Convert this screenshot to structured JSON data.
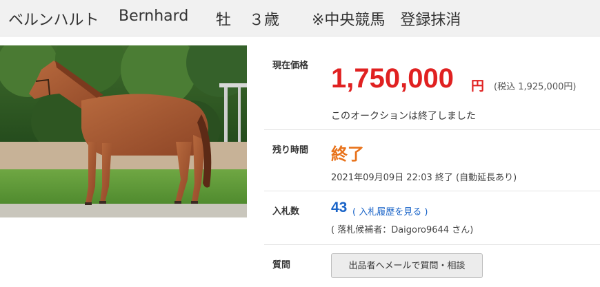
{
  "header": {
    "name_kana": "ベルンハルト",
    "name_en": "Bernhard",
    "sex": "牡",
    "age": "３歳",
    "status": "※中央競馬　登録抹消"
  },
  "photo": {
    "alt": "horse-photo",
    "description": "chestnut horse standing on grass"
  },
  "price": {
    "label": "現在価格",
    "value": "1,750,000",
    "unit": "円",
    "tax": "(税込 1,925,000円)",
    "ended_message": "このオークションは終了しました"
  },
  "remaining": {
    "label": "残り時間",
    "value": "終了",
    "detail": "2021年09月09日 22:03 終了 (自動延長あり)"
  },
  "bids": {
    "label": "入札数",
    "count": "43",
    "history_link": "( 入札履歴を見る )",
    "winner": "( 落札候補者：Daigoro9644 さん)"
  },
  "question": {
    "label": "質問",
    "button": "出品者へメールで質問・相談"
  },
  "colors": {
    "price": "#e02121",
    "remaining": "#e8721a",
    "link": "#1a64c8",
    "header_bg": "#f1f1f1"
  }
}
